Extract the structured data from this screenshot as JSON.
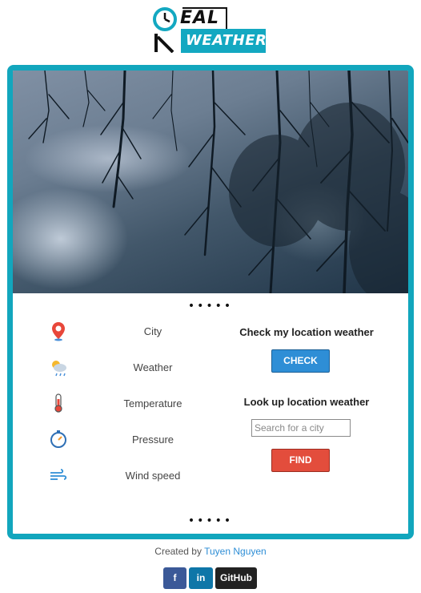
{
  "logo": {
    "top_text": "EAL",
    "box_text": "WEATHER"
  },
  "carousel": {
    "indicator": "•••••"
  },
  "weather_list": [
    {
      "icon": "location-pin-icon",
      "label": "City"
    },
    {
      "icon": "sun-cloud-rain-icon",
      "label": "Weather"
    },
    {
      "icon": "thermometer-icon",
      "label": "Temperature"
    },
    {
      "icon": "pressure-gauge-icon",
      "label": "Pressure"
    },
    {
      "icon": "wind-icon",
      "label": "Wind speed"
    }
  ],
  "check_panel": {
    "title": "Check my location weather",
    "button": "CHECK"
  },
  "lookup_panel": {
    "title": "Look up location weather",
    "placeholder": "Search for a city",
    "button": "FIND"
  },
  "footer": {
    "credit_prefix": "Created by",
    "author": "Tuyen Nguyen",
    "social": {
      "facebook": "f",
      "linkedin": "in",
      "github": "GitHub"
    }
  },
  "colors": {
    "accent": "#12a6bd",
    "check": "#2e8ed6",
    "find": "#e34d3c"
  }
}
